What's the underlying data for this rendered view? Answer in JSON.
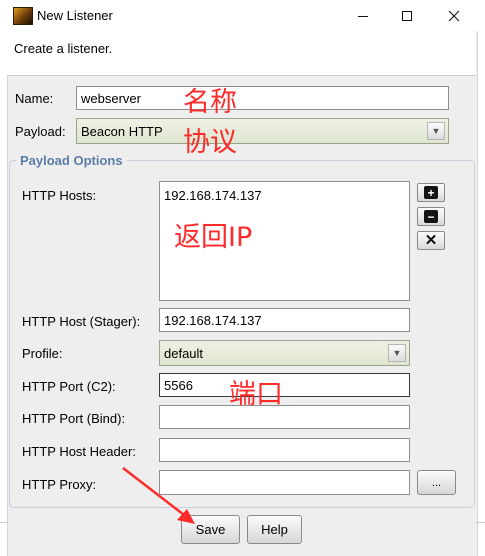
{
  "window": {
    "title": "New Listener",
    "description": "Create a listener."
  },
  "form": {
    "name_label": "Name:",
    "name_value": "webserver",
    "payload_label": "Payload:",
    "payload_value": "Beacon HTTP",
    "group_title": "Payload Options",
    "hosts_label": "HTTP Hosts:",
    "hosts_value": "192.168.174.137",
    "stager_label": "HTTP Host (Stager):",
    "stager_value": "192.168.174.137",
    "profile_label": "Profile:",
    "profile_value": "default",
    "port_c2_label": "HTTP Port (C2):",
    "port_c2_value": "5566",
    "port_bind_label": "HTTP Port (Bind):",
    "port_bind_value": "",
    "host_header_label": "HTTP Host Header:",
    "host_header_value": "",
    "proxy_label": "HTTP Proxy:",
    "proxy_value": "",
    "proxy_button": "..."
  },
  "side_buttons": {
    "add": "+",
    "remove": "−",
    "clear": "✕"
  },
  "buttons": {
    "save": "Save",
    "help": "Help"
  },
  "annotations": {
    "name_note": "名称",
    "payload_note": "协议",
    "ip_note": "返回IP",
    "port_note": "端口"
  },
  "colors": {
    "annotation": "#ff2a2a",
    "group_title": "#5b7da8"
  }
}
